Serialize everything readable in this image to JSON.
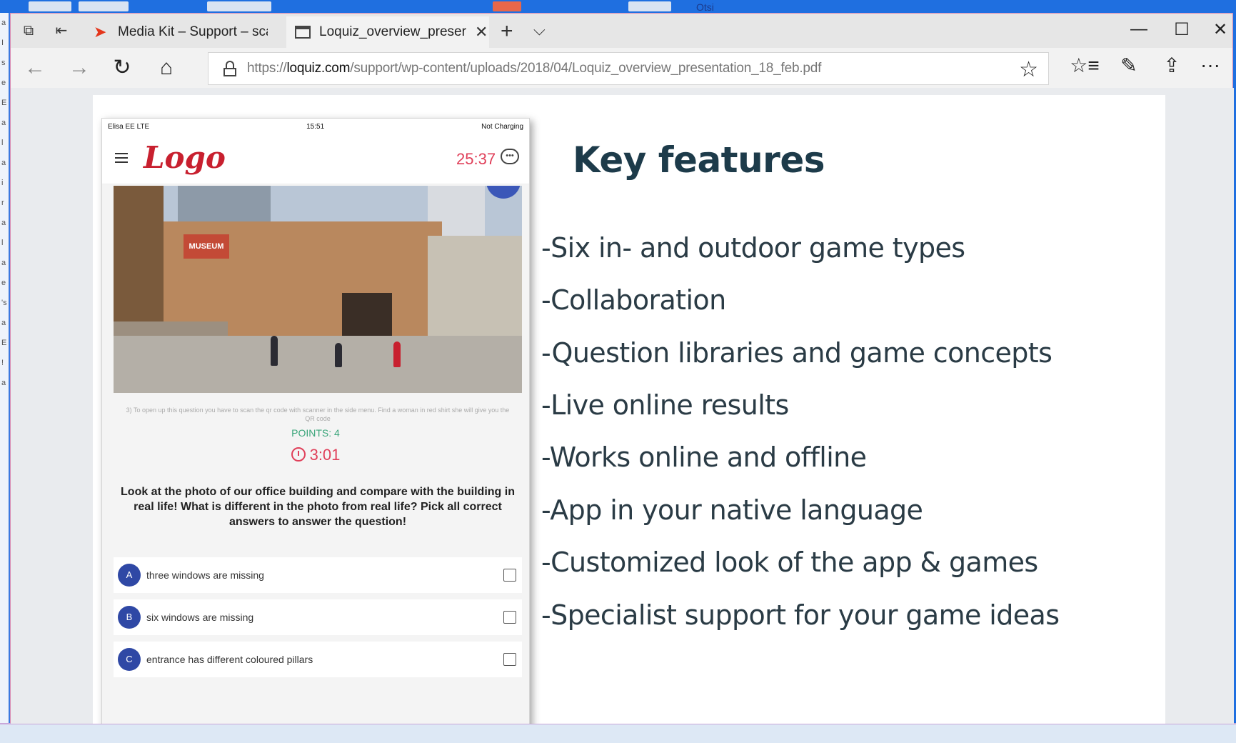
{
  "desktop": {
    "top_badge": "Otsi",
    "left_letters": [
      "a",
      "I",
      "s",
      "e",
      "E",
      "a",
      "l",
      "a",
      "i",
      "r",
      "a",
      "l",
      "a",
      "e",
      "'s",
      "a",
      "E",
      "!",
      "a"
    ]
  },
  "browser": {
    "tabs": [
      {
        "title": "Media Kit – Support – scave",
        "active": false,
        "favicon": "red-arrow-icon"
      },
      {
        "title": "Loquiz_overview_preser",
        "active": true,
        "favicon": "page-icon"
      }
    ],
    "new_tab_label": "+",
    "tab_menu_label": "⌵",
    "window_controls": {
      "minimize": "—",
      "maximize": "☐",
      "close": "✕"
    },
    "nav": {
      "back": "←",
      "forward": "→",
      "refresh": "↻",
      "home": "⌂"
    },
    "url": {
      "prefix": "https://",
      "domain": "loquiz.com",
      "path": "/support/wp-content/uploads/2018/04/Loquiz_overview_presentation_18_feb.pdf"
    },
    "toolbar": {
      "favorite": "☆",
      "favorites_hub": "☆≡",
      "notes": "✎",
      "share": "⇪",
      "more": "···"
    }
  },
  "slide": {
    "phone": {
      "status_left": "Elisa EE  LTE",
      "status_time": "15:51",
      "status_right": "Not Charging",
      "logo": "Logo",
      "timer": "25:37",
      "museum_sign": "MUSEUM",
      "question_hint": "3) To open up this question you have to scan the qr code with scanner in the side menu. Find a woman in red shirt she will give you the QR code",
      "points": "POINTS: 4",
      "question_timer": "3:01",
      "question": "Look at the photo of our office building and compare with the building in real life! What is different in the photo from real life? Pick all correct answers to answer the question!",
      "answers": [
        {
          "letter": "A",
          "text": "three windows are missing"
        },
        {
          "letter": "B",
          "text": "six windows are missing"
        },
        {
          "letter": "C",
          "text": "entrance has different coloured pillars"
        }
      ]
    },
    "title": "Key features",
    "features": [
      "-Six in- and outdoor game types",
      "-Collaboration",
      "-Question libraries and game concepts",
      "-Live online results",
      "-Works online and offline",
      "-App in your native language",
      "-Customized look of the app & games",
      "-Specialist support for your game ideas"
    ]
  }
}
